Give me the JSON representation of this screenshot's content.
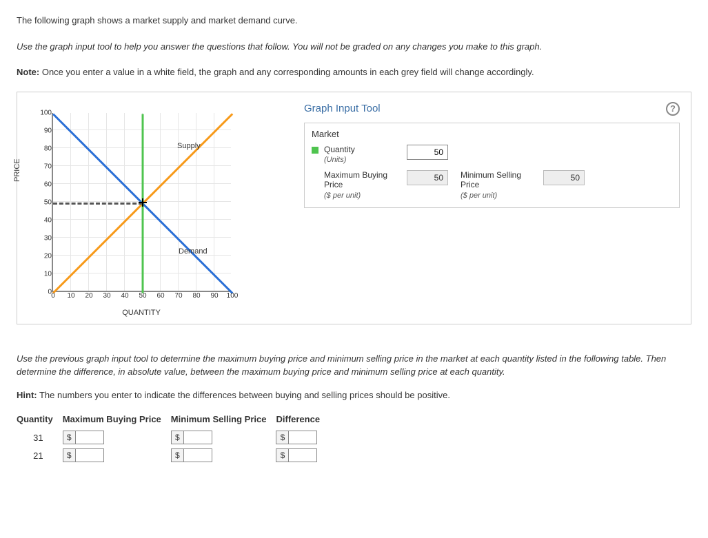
{
  "intro": {
    "line1": "The following graph shows a market supply and market demand curve.",
    "line2": "Use the graph input tool to help you answer the questions that follow. You will not be graded on any changes you make to this graph.",
    "line3_prefix": "Note:",
    "line3_rest": " Once you enter a value in a white field, the graph and any corresponding amounts in each grey field will change accordingly."
  },
  "chart_data": {
    "type": "line",
    "xlabel": "QUANTITY",
    "ylabel": "PRICE",
    "xlim": [
      0,
      100
    ],
    "ylim": [
      0,
      100
    ],
    "x_ticks": [
      0,
      10,
      20,
      30,
      40,
      50,
      60,
      70,
      80,
      90,
      100
    ],
    "y_ticks": [
      0,
      10,
      20,
      30,
      40,
      50,
      60,
      70,
      80,
      90,
      100
    ],
    "series": [
      {
        "name": "Supply",
        "color": "#f79a1a",
        "x": [
          0,
          100
        ],
        "y": [
          0,
          100
        ]
      },
      {
        "name": "Demand",
        "color": "#2a6fd6",
        "x": [
          0,
          100
        ],
        "y": [
          100,
          0
        ]
      }
    ],
    "guides": {
      "quantity_vline_x": 50,
      "price_hline_y": 50,
      "intersection": {
        "x": 50,
        "y": 50
      }
    },
    "series_labels": {
      "supply": "Supply",
      "demand": "Demand"
    }
  },
  "tool": {
    "title": "Graph Input Tool",
    "section": "Market",
    "fields": {
      "quantity": {
        "label": "Quantity",
        "sub": "(Units)",
        "value": "50"
      },
      "max_buy": {
        "label": "Maximum Buying Price",
        "sub": "($ per unit)",
        "value": "50"
      },
      "min_sell": {
        "label": "Minimum Selling Price",
        "sub": "($ per unit)",
        "value": "50"
      }
    }
  },
  "question": {
    "para": "Use the previous graph input tool to determine the maximum buying price and minimum selling price in the market at each quantity listed in the following table. Then determine the difference, in absolute value, between the maximum buying price and minimum selling price at each quantity.",
    "hint_prefix": "Hint:",
    "hint_rest": " The numbers you enter to indicate the differences between buying and selling prices should be positive.",
    "table": {
      "headers": [
        "Quantity",
        "Maximum Buying Price",
        "Minimum Selling Price",
        "Difference"
      ],
      "rows": [
        {
          "q": "31"
        },
        {
          "q": "21"
        }
      ],
      "currency": "$"
    }
  }
}
